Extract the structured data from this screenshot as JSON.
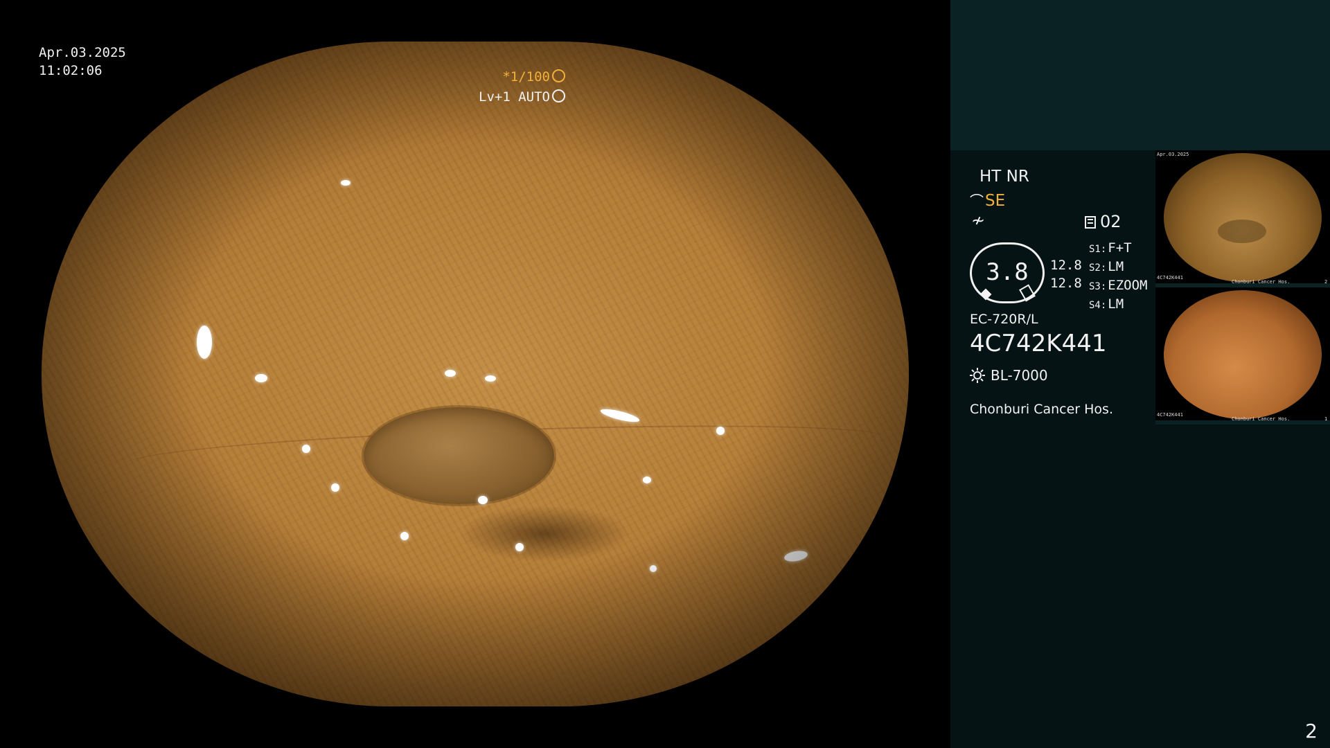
{
  "overlay": {
    "date": "Apr.03.2025",
    "time": "11:02:06",
    "shutter": "*1/100",
    "level": "Lv+1 AUTO"
  },
  "panel": {
    "mode": "HT NR",
    "se": "SE",
    "record_count": "02",
    "zoom": "3.8",
    "aperture_1": "12.8",
    "aperture_2": "12.8",
    "scopes": [
      {
        "label": "S1:",
        "value": "F+T"
      },
      {
        "label": "S2:",
        "value": "LM"
      },
      {
        "label": "S3:",
        "value": "EZOOM"
      },
      {
        "label": "S4:",
        "value": "LM"
      }
    ],
    "model": "EC-720R/L",
    "serial": "4C742K441",
    "light_source": "BL-7000",
    "hospital": "Chonburi Cancer Hos."
  },
  "thumbs": {
    "t1_date": "Apr.03.2025",
    "t1_serial": "4C742K441",
    "t1_hosp": "Chonburi Cancer Hos.",
    "t1_num": "2",
    "t2_serial": "4C742K441",
    "t2_hosp": "Chonburi Cancer Hos.",
    "t2_num": "1"
  },
  "page_number": "2",
  "colors": {
    "accent": "#f2b13a",
    "panel_bg": "#061314",
    "panel_top": "#0b2224"
  }
}
